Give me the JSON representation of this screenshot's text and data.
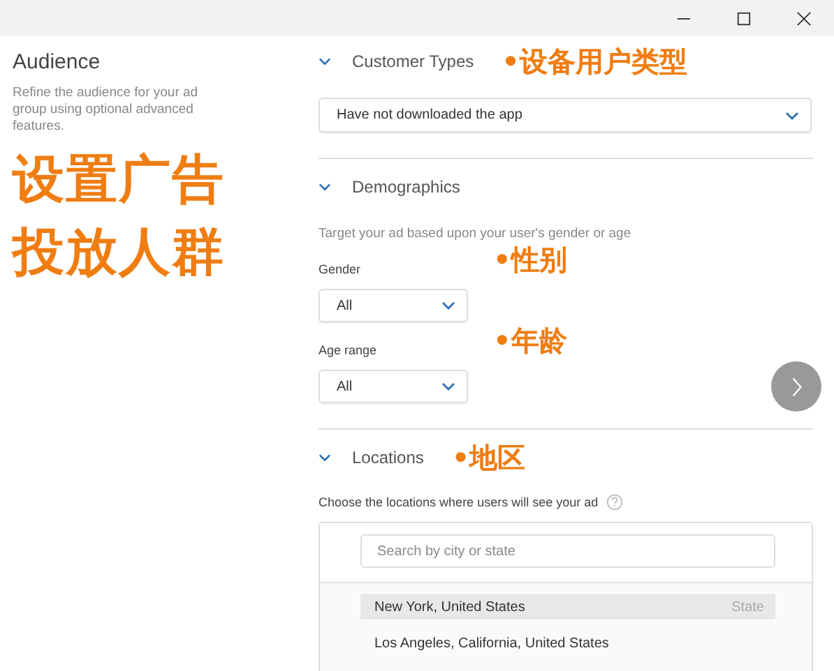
{
  "sidebar": {
    "title": "Audience",
    "description": "Refine the audience for your ad group using optional advanced features.",
    "annotation": "设置广告投放人群"
  },
  "sections": [
    {
      "kind": "select",
      "title": "Customer Types",
      "expanded": true,
      "annotation": "•设备用户类型",
      "value": "Have not downloaded the app"
    },
    {
      "kind": "demographics",
      "title": "Demographics",
      "expanded": true,
      "description": "Target your ad based upon your user's gender or age",
      "fields": [
        {
          "label": "Gender",
          "value": "All",
          "annotation": "•性别"
        },
        {
          "label": "Age range",
          "value": "All",
          "annotation": "•年龄"
        }
      ]
    },
    {
      "kind": "locations",
      "title": "Locations",
      "expanded": true,
      "annotation": "•地区",
      "description": "Choose the locations where users will see your ad",
      "search": {
        "placeholder": "Search by city or state"
      },
      "results": [
        {
          "name": "New York, United States",
          "type": "State",
          "selected": true
        },
        {
          "name": "Los Angeles, California, United States",
          "selected": false
        }
      ]
    }
  ]
}
